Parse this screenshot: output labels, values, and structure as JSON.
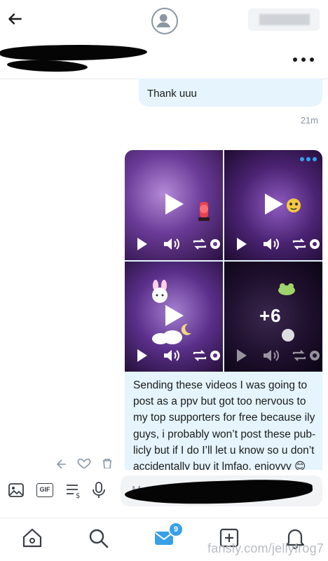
{
  "header": {
    "back_icon": "arrow-left-icon",
    "avatar_icon": "user-avatar-icon",
    "more_icon": "more-horizontal-icon"
  },
  "conversation": {
    "previous_message": "Thank uuu",
    "previous_time": "21m",
    "media": {
      "extra_count": "+6",
      "tiles": [
        {
          "icon": "play-icon"
        },
        {
          "icon": "play-icon"
        },
        {
          "icon": "play-icon"
        },
        {
          "icon": "play-icon"
        }
      ]
    },
    "caption": "Sending these videos I was going to post as a ppv but got too nervous to my top supporters for free because ily guys, i probably won’t post these pub-licly but if I do I’ll let u know so u don’t accidentally buy it lmfao, enjoyyy 😊"
  },
  "composer": {
    "placeholder": "M",
    "image_icon": "image-icon",
    "gif_label": "GIF",
    "price_icon": "price-list-icon",
    "mic_icon": "microphone-icon"
  },
  "bottom_nav": {
    "items": [
      {
        "icon": "home-icon"
      },
      {
        "icon": "search-icon"
      },
      {
        "icon": "messages-icon"
      },
      {
        "icon": "plus-square-icon"
      },
      {
        "icon": "bell-icon"
      }
    ],
    "messages_badge": "9"
  },
  "watermark": "fansly.com/jellyfrog7",
  "colors": {
    "accent": "#38a0e8",
    "bubble": "#e5f4fd",
    "muted": "#8a96a3"
  }
}
